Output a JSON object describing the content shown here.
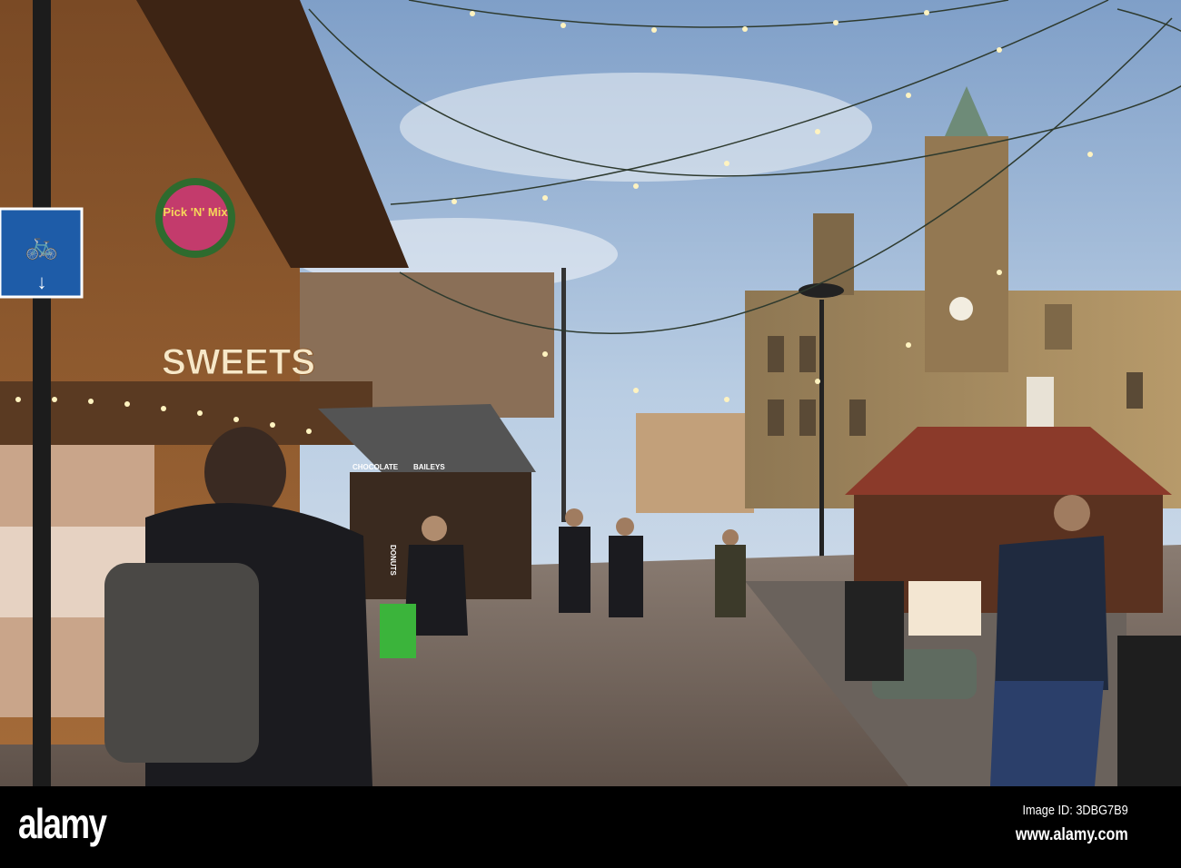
{
  "photo": {
    "signs": {
      "sweets": "SWEETS",
      "pick_n_mix": "Pick 'N' Mix",
      "chocolate": "CHOCOLATE",
      "baileys": "BAILEYS",
      "donuts": "DONUTS"
    }
  },
  "watermark": {
    "logo": "alamy",
    "image_id": "Image ID: 3DBG7B9",
    "url": "www.alamy.com"
  }
}
